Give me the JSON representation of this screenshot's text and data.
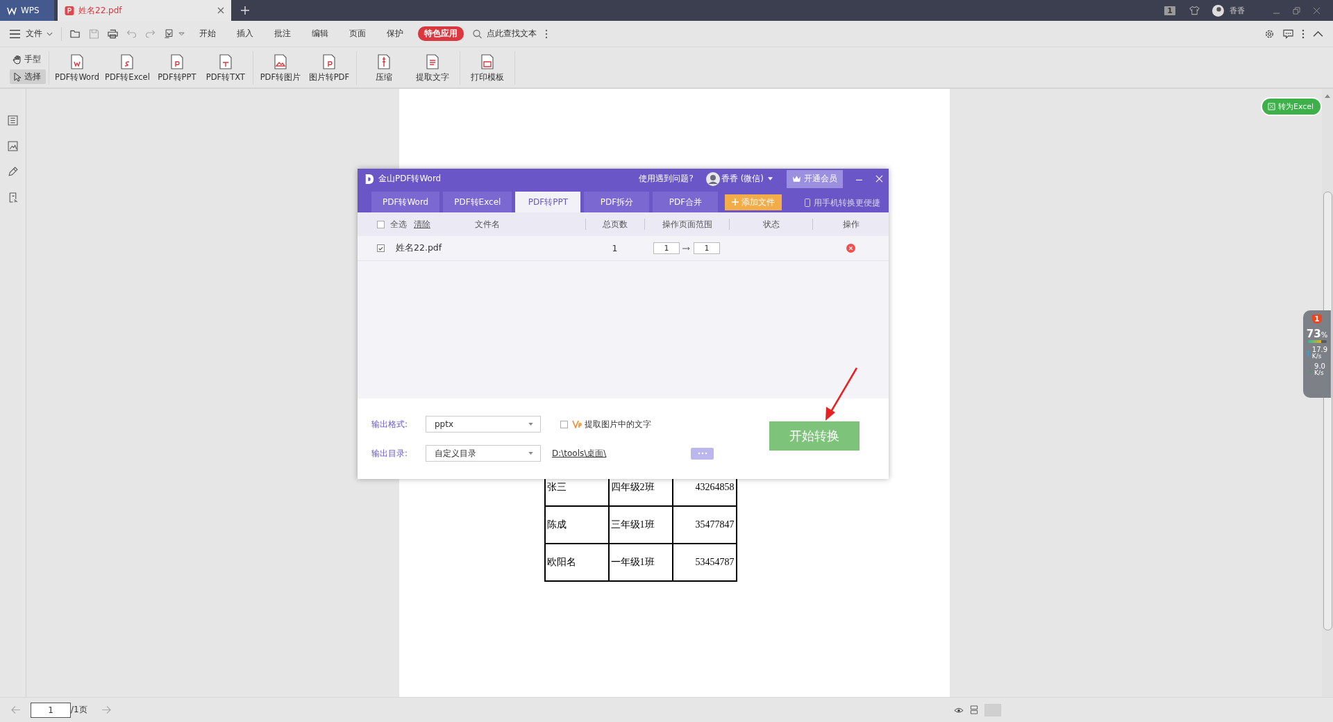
{
  "tabs": [
    {
      "label": "WPS",
      "kind": "home",
      "selected": false
    },
    {
      "label": "姓名22.pdf",
      "kind": "doc",
      "selected": true
    }
  ],
  "title_bar": {
    "page_count": "1",
    "user": "香香"
  },
  "menu": {
    "file": "文件",
    "items": [
      {
        "label": "开始",
        "highlighted": false
      },
      {
        "label": "插入",
        "highlighted": false
      },
      {
        "label": "批注",
        "highlighted": false
      },
      {
        "label": "编辑",
        "highlighted": false
      },
      {
        "label": "页面",
        "highlighted": false
      },
      {
        "label": "保护",
        "highlighted": false
      },
      {
        "label": "特色应用",
        "highlighted": true
      }
    ],
    "search_placeholder": "点此查找文本"
  },
  "tools": {
    "modes": [
      {
        "label": "手型",
        "kind": "hand",
        "selected": false
      },
      {
        "label": "选择",
        "kind": "pointer",
        "selected": true
      }
    ],
    "groups": [
      [
        {
          "label": "PDF转Word",
          "kind": "word"
        },
        {
          "label": "PDF转Excel",
          "kind": "excel"
        },
        {
          "label": "PDF转PPT",
          "kind": "ppt"
        },
        {
          "label": "PDF转TXT",
          "kind": "txt"
        }
      ],
      [
        {
          "label": "PDF转图片",
          "kind": "image"
        },
        {
          "label": "图片转PDF",
          "kind": "topdf"
        }
      ],
      [
        {
          "label": "压缩",
          "kind": "zip"
        },
        {
          "label": "提取文字",
          "kind": "extract"
        }
      ],
      [
        {
          "label": "打印模板",
          "kind": "print"
        }
      ]
    ]
  },
  "document": {
    "table": [
      [
        "张三",
        "四年级2班",
        "43264858"
      ],
      [
        "陈成",
        "三年级1班",
        "35477847"
      ],
      [
        "欧阳名",
        "一年级1班",
        "53454787"
      ]
    ]
  },
  "dialog": {
    "title": "金山PDF转Word",
    "help": "使用遇到问题?",
    "user": "香香 (微信)",
    "vip": "开通会员",
    "tabs": [
      {
        "label": "PDF转Word",
        "selected": false
      },
      {
        "label": "PDF转Excel",
        "selected": false
      },
      {
        "label": "PDF转PPT",
        "selected": true
      },
      {
        "label": "PDF拆分",
        "selected": false
      },
      {
        "label": "PDF合并",
        "selected": false
      }
    ],
    "add_file": "添加文件",
    "mobile": "用手机转换更便捷",
    "select_all": {
      "label": "全选",
      "checked": false
    },
    "clear": "清除",
    "columns": [
      "文件名",
      "总页数",
      "操作页面范围",
      "状态",
      "操作"
    ],
    "files": [
      {
        "checked": true,
        "name": "姓名22.pdf",
        "pages": "1",
        "from": "1",
        "to": "1"
      }
    ],
    "format_label": "输出格式:",
    "format": "pptx",
    "ocr": {
      "label": "提取图片中的文字",
      "checked": false
    },
    "dir_label": "输出目录:",
    "dir": "自定义目录",
    "path": "D:\\tools\\桌面\\",
    "start": "开始转换"
  },
  "side_button": "转为Excel",
  "net_widget": {
    "badge": "1",
    "percent": "73",
    "unit": "%",
    "level": 0.73,
    "up": "17.9",
    "up_unit": "K/s",
    "down": "9.0",
    "down_unit": "K/s"
  },
  "status_bar": {
    "page": "1",
    "total": "/1页"
  }
}
